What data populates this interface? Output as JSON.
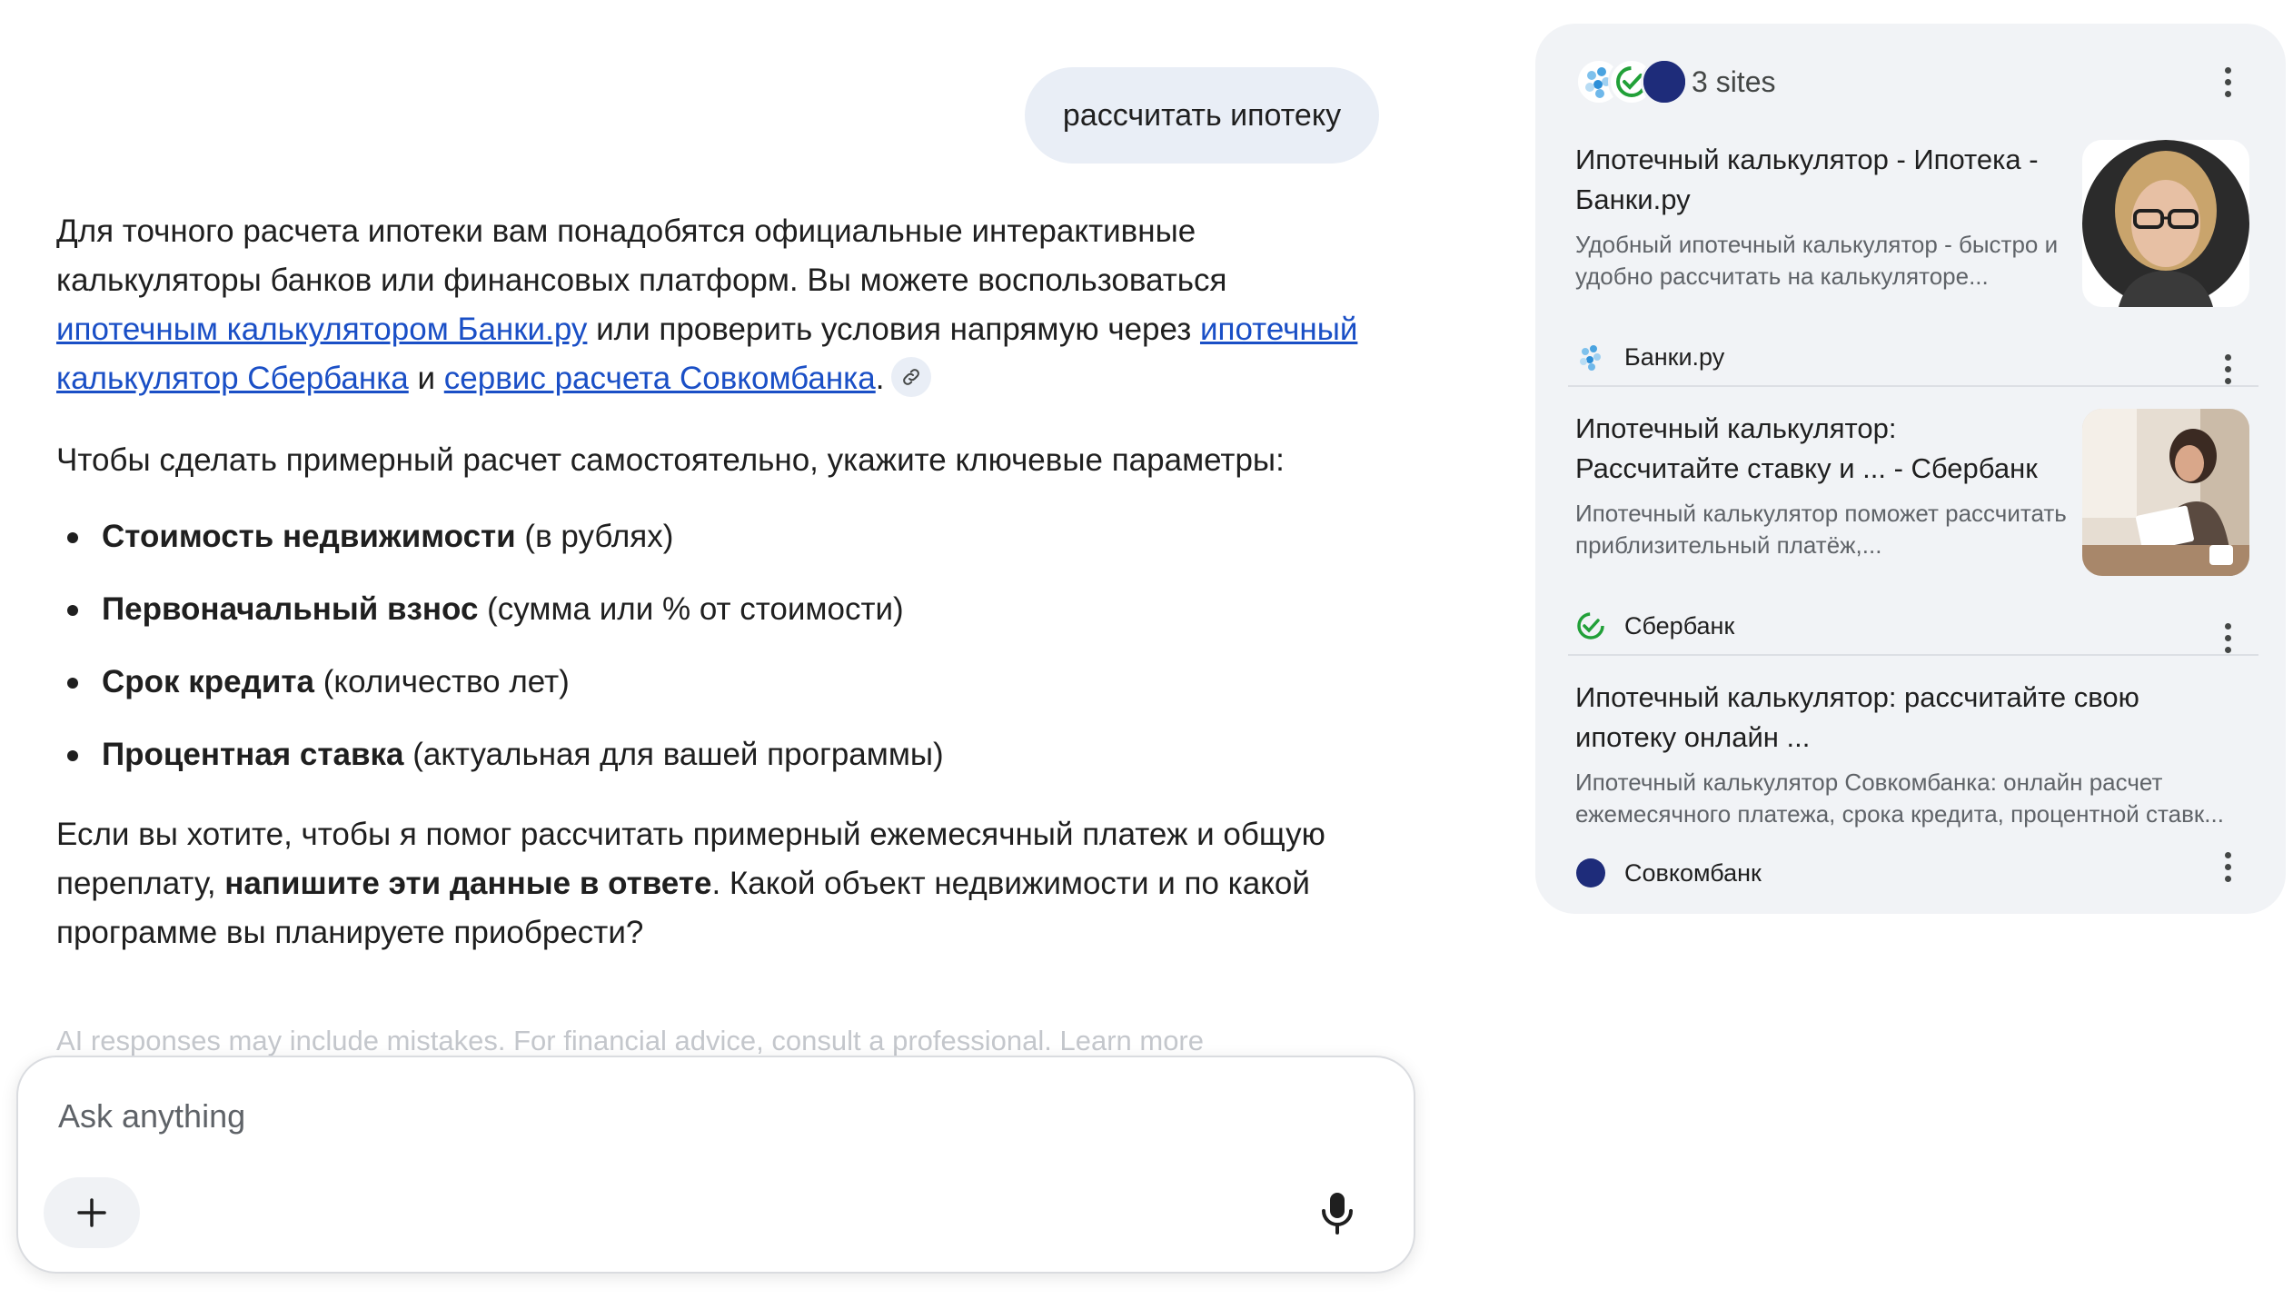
{
  "user_query": "рассчитать ипотеку",
  "answer": {
    "p1_a": "Для точного расчета ипотеки вам понадобятся официальные интерактивные калькуляторы банков или финансовых платформ. Вы можете воспользоваться ",
    "p1_link1": "ипотечным калькулятором Банки.ру",
    "p1_b": " или проверить условия напрямую через ",
    "p1_link2": "ипотечный калькулятор Сбербанка",
    "p1_c": " и ",
    "p1_link3": "сервис расчета Совкомбанка",
    "p1_d": ".",
    "p2": "Чтобы сделать примерный расчет самостоятельно, укажите ключевые параметры:",
    "bullets": [
      {
        "bold": "Стоимость недвижимости",
        "rest": " (в рублях)"
      },
      {
        "bold": "Первоначальный взнос",
        "rest": " (сумма или % от стоимости)"
      },
      {
        "bold": "Срок кредита",
        "rest": " (количество лет)"
      },
      {
        "bold": "Процентная ставка",
        "rest": " (актуальная для вашей программы)"
      }
    ],
    "p3_a": "Если вы хотите, чтобы я помог рассчитать примерный ежемесячный платеж и общую переплату, ",
    "p3_bold": "напишите эти данные в ответе",
    "p3_b": ". Какой объект недвижимости и по какой программе вы планируете приобрести?"
  },
  "disclaimer": "AI responses may include mistakes. For financial advice, consult a professional. Learn more",
  "input": {
    "placeholder": "Ask anything"
  },
  "sources": {
    "count_label": "3 sites",
    "cards": [
      {
        "title": "Ипотечный калькулятор - Ипотека - Банки.ру",
        "snippet": "Удобный ипотечный калькулятор - быстро и удобно рассчитать на калькуляторе...",
        "source": "Банки.ру",
        "icon": "banki-ru-icon"
      },
      {
        "title": "Ипотечный калькулятор: Рассчитайте ставку и ... - Сбербанк",
        "snippet": "Ипотечный калькулятор поможет рассчитать приблизительный платёж,...",
        "source": "Сбербанк",
        "icon": "sberbank-icon"
      },
      {
        "title": "Ипотечный калькулятор: рассчитайте свою ипотеку онлайн ...",
        "snippet": "Ипотечный калькулятор Совкомбанка: онлайн расчет ежемесячного платежа, срока кредита, процентной ставк...",
        "source": "Совкомбанк",
        "icon": "sovcombank-icon"
      }
    ]
  },
  "colors": {
    "link": "#1a4fc6",
    "bubble": "#e9eef6",
    "panel": "#f1f3f6",
    "sber_green": "#21a038",
    "sovcom_blue": "#1e2c7a",
    "sovcom_red": "#e3263a"
  }
}
